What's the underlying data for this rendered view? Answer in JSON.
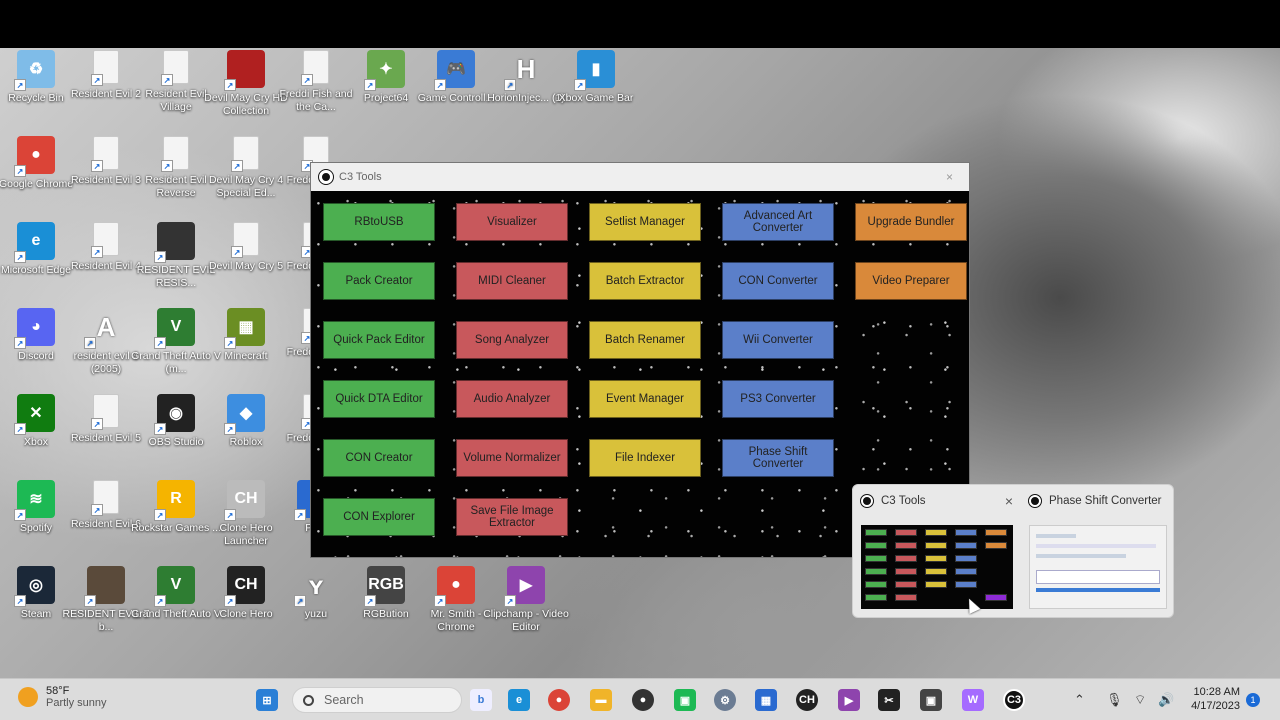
{
  "desktop": {
    "icons": [
      {
        "label": "Recycle Bin",
        "x": 0,
        "y": 0,
        "kind": "app",
        "color": "#7fbce8",
        "glyph": "♻"
      },
      {
        "label": "Resident Evil 2",
        "x": 1,
        "y": 0,
        "kind": "doc"
      },
      {
        "label": "Resident Evil Village",
        "x": 2,
        "y": 0,
        "kind": "doc"
      },
      {
        "label": "Devil May Cry HD Collection",
        "x": 3,
        "y": 0,
        "kind": "app",
        "color": "#b02020",
        "glyph": ""
      },
      {
        "label": "Freddi Fish and the Ca...",
        "x": 4,
        "y": 0,
        "kind": "doc"
      },
      {
        "label": "Project64",
        "x": 5,
        "y": 0,
        "kind": "app",
        "color": "#6aa84f",
        "glyph": "✦"
      },
      {
        "label": "Game Controll...",
        "x": 6,
        "y": 0,
        "kind": "app",
        "color": "#3a7bd5",
        "glyph": "🎮"
      },
      {
        "label": "HorionInjec... (1)",
        "x": 7,
        "y": 0,
        "kind": "app",
        "color": "transparent",
        "glyph": "H"
      },
      {
        "label": "Xbox Game Bar",
        "x": 8,
        "y": 0,
        "kind": "app",
        "color": "#2a8fd6",
        "glyph": "▮"
      },
      {
        "label": "Google Chrome",
        "x": 0,
        "y": 1,
        "kind": "app",
        "color": "#db4437",
        "glyph": "●"
      },
      {
        "label": "Resident Evil 3",
        "x": 1,
        "y": 1,
        "kind": "doc"
      },
      {
        "label": "Resident Evil Reverse",
        "x": 2,
        "y": 1,
        "kind": "doc"
      },
      {
        "label": "Devil May Cry 4 Special Ed...",
        "x": 3,
        "y": 1,
        "kind": "doc"
      },
      {
        "label": "Fredd The C",
        "x": 4,
        "y": 1,
        "kind": "doc"
      },
      {
        "label": "Microsoft Edge",
        "x": 0,
        "y": 2,
        "kind": "app",
        "color": "#1a8fd6",
        "glyph": "e"
      },
      {
        "label": "Resident Evil 4",
        "x": 1,
        "y": 2,
        "kind": "doc"
      },
      {
        "label": "RESIDENT EVIL RESIS...",
        "x": 2,
        "y": 2,
        "kind": "app",
        "color": "#333",
        "glyph": ""
      },
      {
        "label": "Devil May Cry 5",
        "x": 3,
        "y": 2,
        "kind": "doc"
      },
      {
        "label": "Fredd The C",
        "x": 4,
        "y": 2,
        "kind": "doc"
      },
      {
        "label": "Discord",
        "x": 0,
        "y": 3,
        "kind": "app",
        "color": "#5865f2",
        "glyph": "◕"
      },
      {
        "label": "resident evil 4 (2005)",
        "x": 1,
        "y": 3,
        "kind": "app",
        "color": "transparent",
        "glyph": "A"
      },
      {
        "label": "Grand Theft Auto V (m...",
        "x": 2,
        "y": 3,
        "kind": "app",
        "color": "#2e7d32",
        "glyph": "V"
      },
      {
        "label": "Minecraft",
        "x": 3,
        "y": 3,
        "kind": "app",
        "color": "#6b8e23",
        "glyph": "▦"
      },
      {
        "label": "Fredd The C",
        "x": 4,
        "y": 3,
        "kind": "doc"
      },
      {
        "label": "Xbox",
        "x": 0,
        "y": 4,
        "kind": "app",
        "color": "#107c10",
        "glyph": "✕"
      },
      {
        "label": "Resident Evil 5",
        "x": 1,
        "y": 4,
        "kind": "doc"
      },
      {
        "label": "OBS Studio",
        "x": 2,
        "y": 4,
        "kind": "app",
        "color": "#222",
        "glyph": "◉"
      },
      {
        "label": "Roblox",
        "x": 3,
        "y": 4,
        "kind": "app",
        "color": "#3d8ee0",
        "glyph": "◆"
      },
      {
        "label": "Fredd The C",
        "x": 4,
        "y": 4,
        "kind": "doc"
      },
      {
        "label": "Spotify",
        "x": 0,
        "y": 5,
        "kind": "app",
        "color": "#1db954",
        "glyph": "≋"
      },
      {
        "label": "Resident Evil 6",
        "x": 1,
        "y": 5,
        "kind": "doc"
      },
      {
        "label": "Rockstar Games ...",
        "x": 2,
        "y": 5,
        "kind": "app",
        "color": "#f5b400",
        "glyph": "R"
      },
      {
        "label": "Clone Hero Launcher",
        "x": 3,
        "y": 5,
        "kind": "app",
        "color": "#bbb",
        "glyph": "CH"
      },
      {
        "label": "PCS",
        "x": 4,
        "y": 5,
        "kind": "app",
        "color": "#2a6ad0",
        "glyph": ""
      },
      {
        "label": "Steam",
        "x": 0,
        "y": 6,
        "kind": "app",
        "color": "#1b2838",
        "glyph": "◎"
      },
      {
        "label": "RESIDENT EVIL 7 b...",
        "x": 1,
        "y": 6,
        "kind": "app",
        "color": "#5a4a3a",
        "glyph": ""
      },
      {
        "label": "Grand Theft Auto V",
        "x": 2,
        "y": 6,
        "kind": "app",
        "color": "#2e7d32",
        "glyph": "V"
      },
      {
        "label": "Clone Hero",
        "x": 3,
        "y": 6,
        "kind": "app",
        "color": "#222",
        "glyph": "CH"
      },
      {
        "label": "yuzu",
        "x": 4,
        "y": 6,
        "kind": "app",
        "color": "transparent",
        "glyph": "ʏ"
      },
      {
        "label": "RGBution",
        "x": 5,
        "y": 6,
        "kind": "app",
        "color": "#444",
        "glyph": "RGB"
      },
      {
        "label": "Mr. Smith - Chrome",
        "x": 6,
        "y": 6,
        "kind": "app",
        "color": "#db4437",
        "glyph": "●"
      },
      {
        "label": "Clipchamp - Video Editor",
        "x": 7,
        "y": 6,
        "kind": "app",
        "color": "#8e44ad",
        "glyph": "▶"
      }
    ]
  },
  "c3": {
    "title": "C3 Tools",
    "close_glyph": "×",
    "columns": [
      {
        "color": "#4caf50",
        "buttons": [
          {
            "label": "RBtoUSB",
            "row": 0
          },
          {
            "label": "Pack Creator",
            "row": 1
          },
          {
            "label": "Quick Pack Editor",
            "row": 2
          },
          {
            "label": "Quick DTA Editor",
            "row": 3
          },
          {
            "label": "CON Creator",
            "row": 4
          },
          {
            "label": "CON Explorer",
            "row": 5
          }
        ]
      },
      {
        "color": "#c8585c",
        "buttons": [
          {
            "label": "Visualizer",
            "row": 0
          },
          {
            "label": "MIDI Cleaner",
            "row": 1
          },
          {
            "label": "Song Analyzer",
            "row": 2
          },
          {
            "label": "Audio Analyzer",
            "row": 3
          },
          {
            "label": "Volume Normalizer",
            "row": 4
          },
          {
            "label": "Save File Image Extractor",
            "row": 5
          }
        ]
      },
      {
        "color": "#d9c13a",
        "buttons": [
          {
            "label": "Setlist Manager",
            "row": 0
          },
          {
            "label": "Batch Extractor",
            "row": 1
          },
          {
            "label": "Batch Renamer",
            "row": 2
          },
          {
            "label": "Event Manager",
            "row": 3
          },
          {
            "label": "File Indexer",
            "row": 4
          }
        ]
      },
      {
        "color": "#5b7fc9",
        "buttons": [
          {
            "label": "Advanced Art Converter",
            "row": 0
          },
          {
            "label": "CON Converter",
            "row": 1
          },
          {
            "label": "Wii Converter",
            "row": 2
          },
          {
            "label": "PS3 Converter",
            "row": 3
          },
          {
            "label": "Phase Shift Converter",
            "row": 4
          }
        ]
      },
      {
        "color": "#d9893a",
        "buttons": [
          {
            "label": "Upgrade Bundler",
            "row": 0
          },
          {
            "label": "Video Preparer",
            "row": 1
          }
        ]
      }
    ],
    "settings": {
      "label": "Settings",
      "color": "#8e2bd6"
    }
  },
  "preview": {
    "c3_title": "C3 Tools",
    "close_glyph": "×",
    "other_title": "Phase Shift Converter"
  },
  "taskbar": {
    "weather_temp": "58°F",
    "weather_desc": "Partly sunny",
    "search_placeholder": "Search",
    "time": "10:28 AM",
    "date": "4/17/2023",
    "notifications": "1"
  }
}
